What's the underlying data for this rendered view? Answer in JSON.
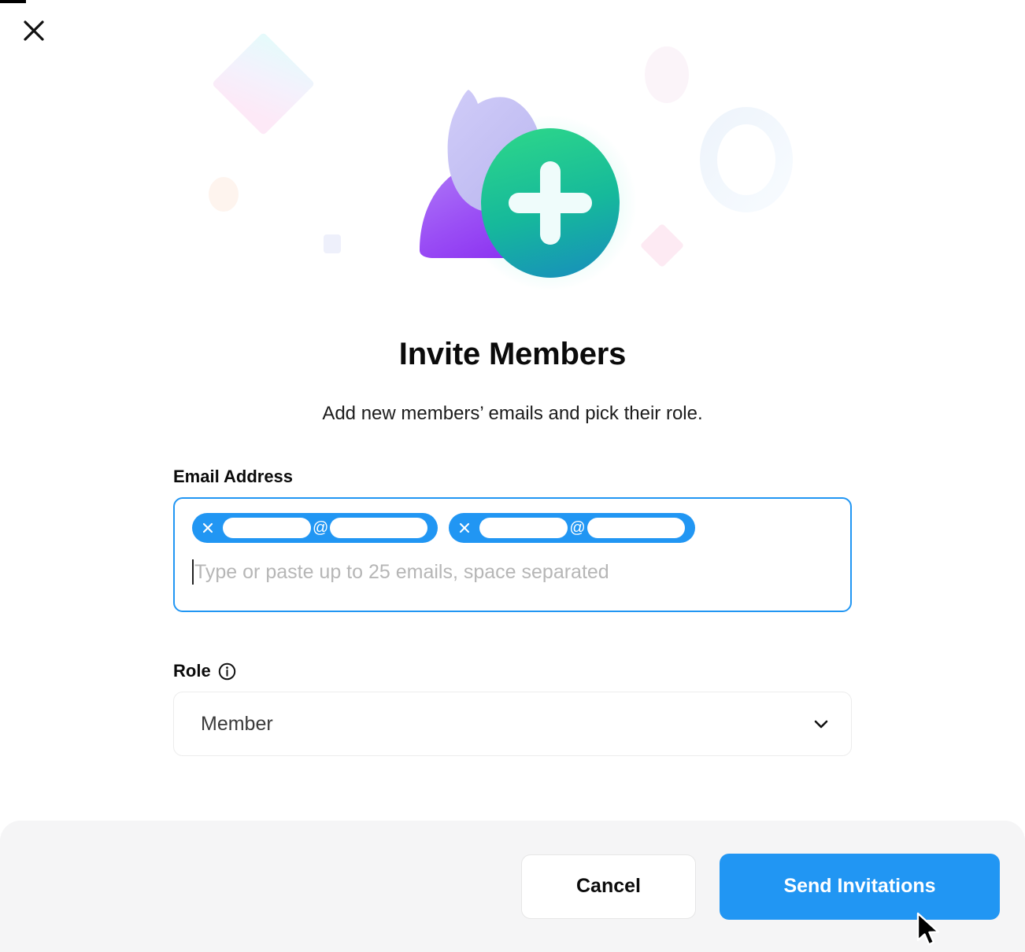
{
  "dialog": {
    "title": "Invite Members",
    "subtitle": "Add new members’ emails and pick their role.",
    "close_label": "×"
  },
  "illustration": {
    "name": "invite-members-illustration",
    "plus_badge_color_start": "#22c98a",
    "plus_badge_color_end": "#1aa6b8",
    "person_head_color": "#c5c2f2",
    "person_body_color_start": "#a855f7",
    "person_body_color_end": "#7c3aed"
  },
  "email_field": {
    "label": "Email Address",
    "placeholder": "Type or paste up to 25 emails, space separated",
    "max_emails": 25,
    "border_color": "#2196F3",
    "chips": [
      {
        "remove_label": "×",
        "local": "",
        "separator": "@",
        "domain": "",
        "redacted": true
      },
      {
        "remove_label": "×",
        "local": "",
        "separator": "@",
        "domain": "",
        "redacted": true
      }
    ]
  },
  "role_field": {
    "label": "Role",
    "info_tooltip_icon": "info-icon",
    "selected": "Member",
    "options": [
      "Member"
    ]
  },
  "footer": {
    "cancel_label": "Cancel",
    "submit_label": "Send Invitations",
    "submit_color": "#2196F3",
    "background_color": "#f5f5f6"
  }
}
